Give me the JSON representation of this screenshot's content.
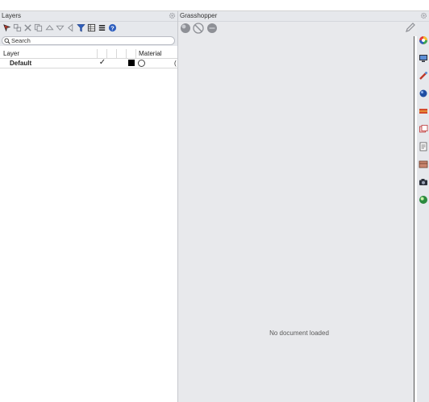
{
  "layers_panel": {
    "title": "Layers",
    "toolbar_icons": [
      "new-layer-icon",
      "new-sublayer-icon",
      "delete-icon",
      "copy-icon",
      "move-up-icon",
      "move-down-icon",
      "move-left-icon",
      "filter-icon",
      "table-icon",
      "menu-icon",
      "help-icon"
    ],
    "search": {
      "placeholder": "Search",
      "value": ""
    },
    "columns": [
      "Layer",
      "",
      "",
      "",
      "",
      "Material"
    ],
    "rows": [
      {
        "name": "Default",
        "current_check": "✓",
        "color": "#000000",
        "cutoff_text": "("
      }
    ]
  },
  "grasshopper_panel": {
    "title": "Grasshopper",
    "toolbar_icons": [
      "preview-shaded-icon",
      "preview-disabled-icon",
      "preview-selected-icon"
    ],
    "message": "No document loaded",
    "right_tabs": [
      "color-wheel-icon",
      "display-icon",
      "render-icon",
      "environment-icon",
      "ground-plane-icon",
      "sun-icon",
      "notes-icon",
      "named-views-icon",
      "camera-icon",
      "materials-icon"
    ]
  },
  "colors": {
    "panel_bg": "#e6e8ec",
    "canvas_bg": "#e8e9ec",
    "accent_blue": "#2f5fbf"
  }
}
